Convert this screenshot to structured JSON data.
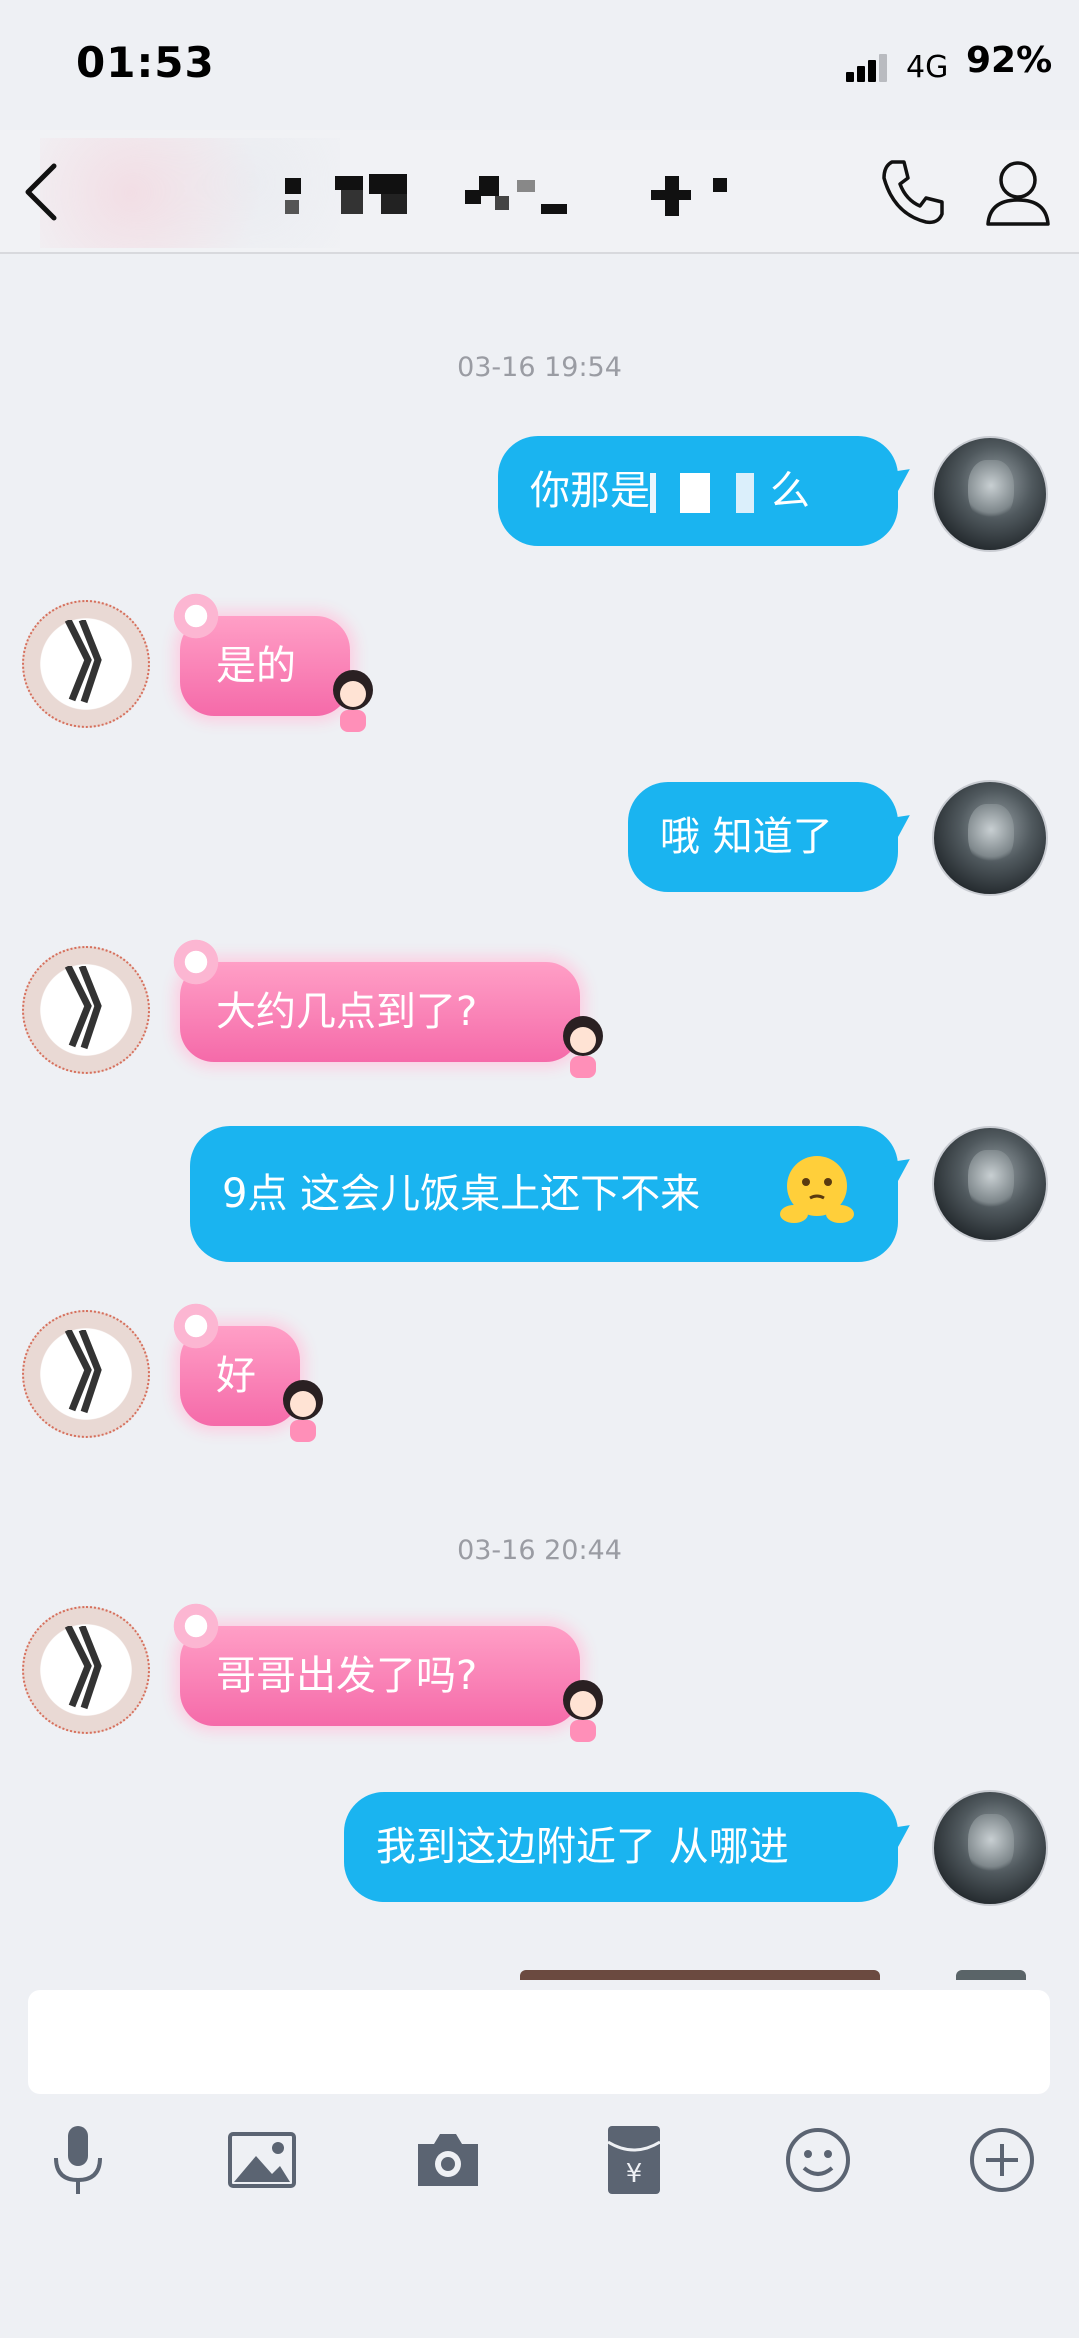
{
  "status_bar": {
    "time": "01:53",
    "network": "4G",
    "battery": "92%"
  },
  "nav": {
    "title_redacted": true
  },
  "icons": {
    "back": "chevron-left-icon",
    "call": "phone-icon",
    "profile": "person-icon",
    "voice": "microphone-icon",
    "image": "image-icon",
    "camera": "camera-icon",
    "red_packet": "red-packet-icon",
    "emoji": "smiley-icon",
    "more": "plus-circle-icon"
  },
  "colors": {
    "outgoing_bubble": "#1ab4f0",
    "incoming_bubble": "#f56aa9",
    "background": "#eef0f4"
  },
  "messages": {
    "ts1": "03-16 19:54",
    "m1": "你那是",
    "m1_tail": "么",
    "m2": "是的",
    "m3": "哦 知道了",
    "m4": "大约几点到了?",
    "m5": "9点 这会儿饭桌上还下不来",
    "m6": "好",
    "ts2": "03-16 20:44",
    "m7": "哥哥出发了吗?",
    "m8": "我到这边附近了 从哪进"
  },
  "input": {
    "placeholder": ""
  }
}
